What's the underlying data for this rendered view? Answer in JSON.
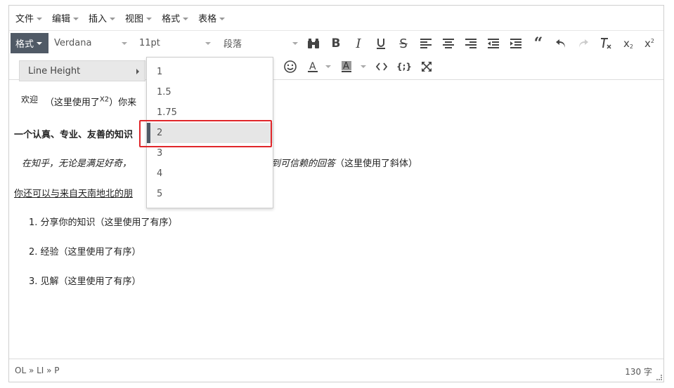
{
  "menubar": {
    "items": [
      "文件",
      "编辑",
      "插入",
      "视图",
      "格式",
      "表格"
    ]
  },
  "toolbar": {
    "format_label": "格式",
    "font_family": "Verdana",
    "font_size": "11pt",
    "block_format": "段落",
    "icons_row1": [
      "find-replace-icon",
      "bold-icon",
      "italic-icon",
      "underline-icon",
      "strikethrough-icon",
      "align-left-icon",
      "align-center-icon",
      "align-right-icon",
      "outdent-icon",
      "indent-icon",
      "blockquote-icon",
      "undo-icon",
      "redo-icon",
      "clear-format-icon",
      "subscript-icon",
      "superscript-icon"
    ],
    "icons_row2": [
      "emoticons-icon",
      "text-color-icon",
      "background-color-icon",
      "code-icon",
      "codesample-icon",
      "fullscreen-icon"
    ]
  },
  "format_menu": {
    "line_height_label": "Line Height"
  },
  "line_height_options": [
    "1",
    "1.5",
    "1.75",
    "2",
    "3",
    "4",
    "5"
  ],
  "line_height_selected": "2",
  "content": {
    "line1_a": "欢迎",
    "line1_b": "（这里使用了",
    "line1_sup": "X2",
    "line1_c": "）你来",
    "line2": "一个认真、专业、友善的知识",
    "line3_a": "在知乎，无论是满足好奇，",
    "line3_b": "获到可信赖的回答",
    "line3_c": "（这里使用了斜体）",
    "line4": "你还可以与来自天南地北的朋",
    "list": [
      "分享你的知识（这里使用了有序）",
      "经验（这里使用了有序）",
      "见解（这里使用了有序）"
    ]
  },
  "statusbar": {
    "path": "OL » LI » P",
    "wordcount": "130 字"
  },
  "colors": {
    "active_button": "#505a66",
    "highlight": "#e0262a"
  }
}
